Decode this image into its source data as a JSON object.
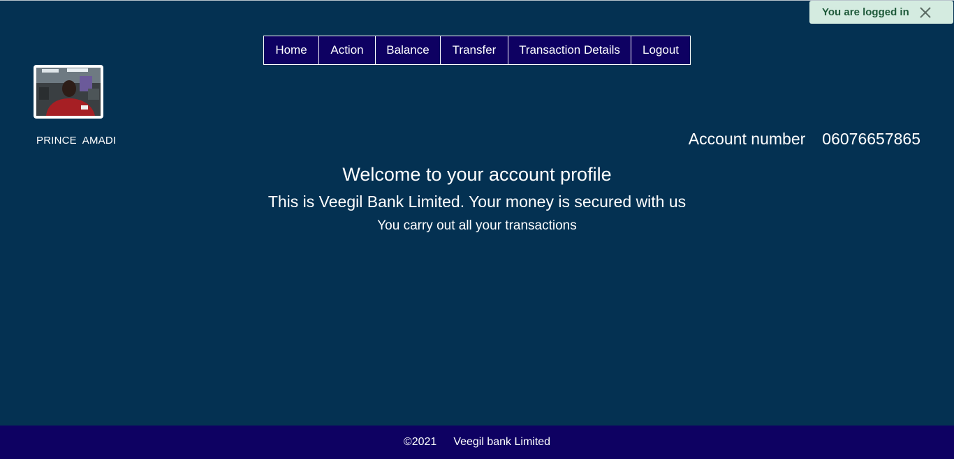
{
  "toast": {
    "message": "You are logged in",
    "close_icon": "close-icon"
  },
  "nav": {
    "items": [
      {
        "label": "Home"
      },
      {
        "label": "Action"
      },
      {
        "label": "Balance"
      },
      {
        "label": "Transfer"
      },
      {
        "label": "Transaction Details"
      },
      {
        "label": "Logout"
      }
    ]
  },
  "profile": {
    "name": "PRINCE  AMADI",
    "account_label": "Account number",
    "account_number": "06076657865"
  },
  "main": {
    "welcome": "Welcome to your account profile",
    "tagline": "This is Veegil Bank Limited. Your money is secured with us",
    "subtitle": "You carry out all your transactions"
  },
  "footer": {
    "copyright": "©2021",
    "company": "Veegil bank Limited"
  },
  "colors": {
    "background": "#043152",
    "nav_background": "#0e0162",
    "footer_background": "#0e0162",
    "toast_background": "#d4ebe0",
    "toast_text": "#1f5a3a"
  }
}
